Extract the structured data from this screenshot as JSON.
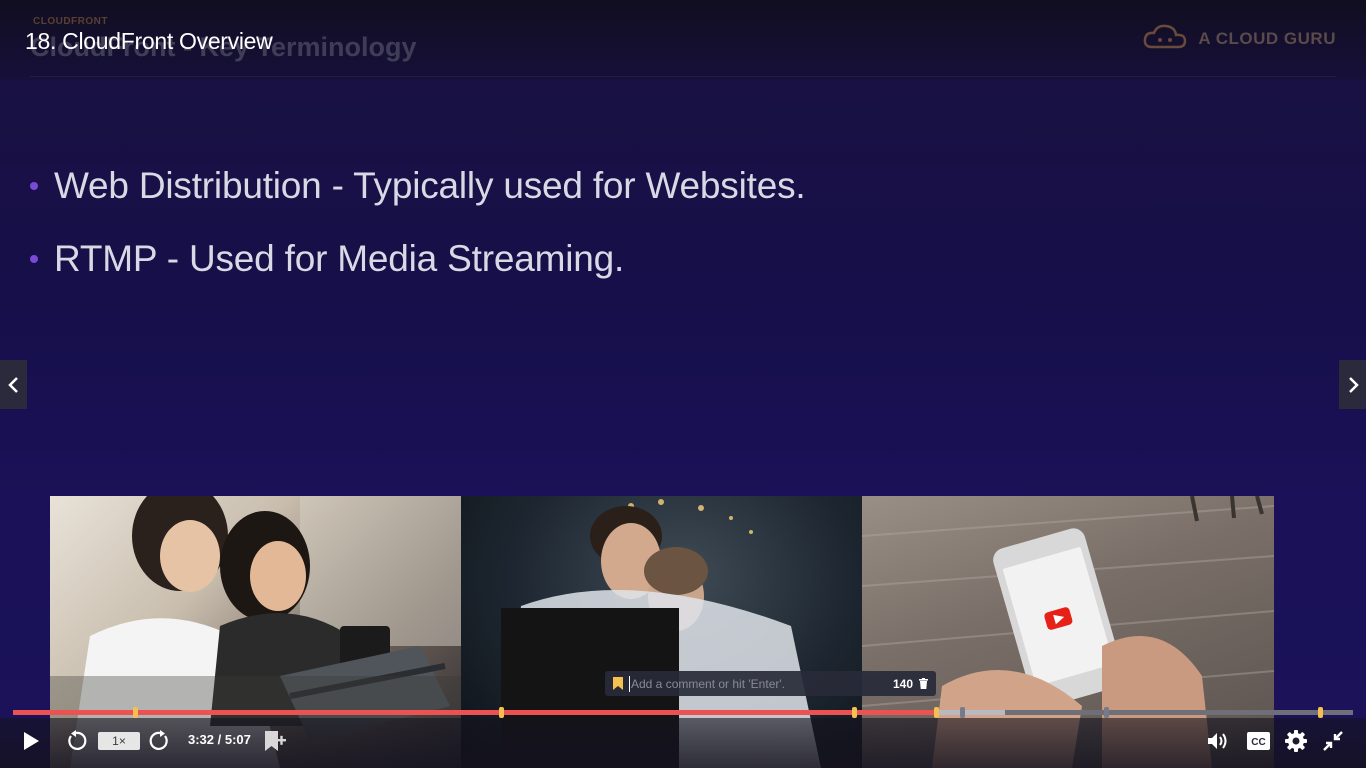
{
  "lecture": {
    "title": "18. CloudFront Overview"
  },
  "slide": {
    "kicker": "CLOUDFRONT",
    "heading": "CloudFront - Key Terminology",
    "brand": "A CLOUD GURU",
    "bullets": [
      "Web Distribution - Typically used for Websites.",
      "RTMP - Used for Media Streaming."
    ]
  },
  "comment": {
    "placeholder": "Add a comment or hit 'Enter'.",
    "char_count": "140"
  },
  "player": {
    "speed_label": "1×",
    "time": "3:32 / 5:07",
    "progress_played": 0.69,
    "progress_buffered": 0.74
  },
  "icons": {
    "play": "play-icon",
    "rewind": "rewind-5-icon",
    "forward": "forward-5-icon",
    "bookmark": "add-bookmark-icon",
    "volume": "volume-icon",
    "captions": "cc-icon",
    "settings": "gear-icon",
    "fullscreen": "exit-fullscreen-icon",
    "prev": "chevron-left-icon",
    "next": "chevron-right-icon",
    "trash": "trash-icon",
    "comment_bookmark": "bookmark-icon"
  },
  "colors": {
    "accent": "#ec5252",
    "marker": "#f4c150",
    "background": "#160f4a"
  }
}
